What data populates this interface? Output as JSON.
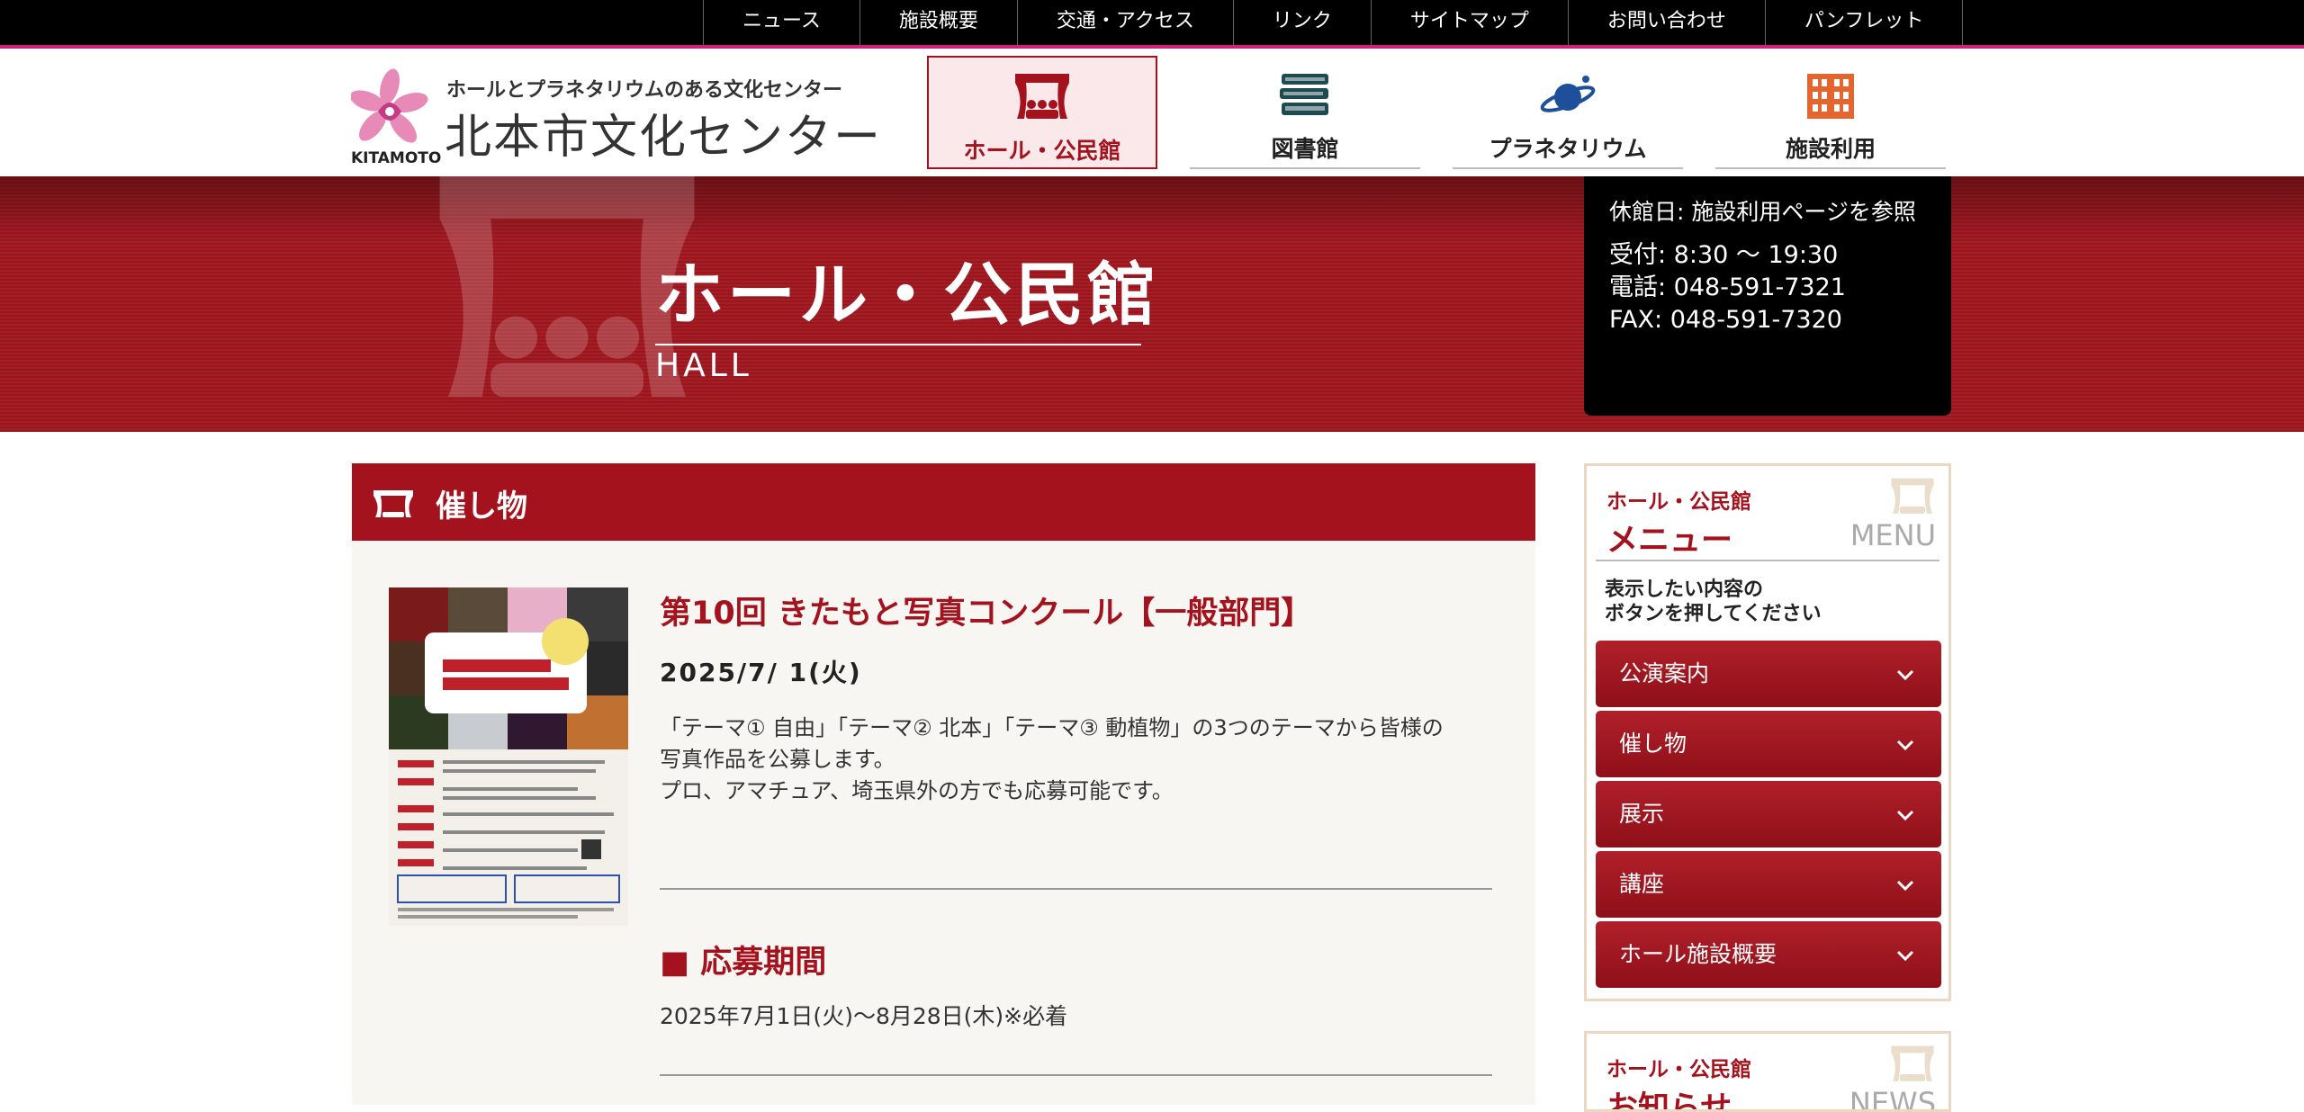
{
  "top_nav": [
    "ニュース",
    "施設概要",
    "交通・アクセス",
    "リンク",
    "サイトマップ",
    "お問い合わせ",
    "パンフレット"
  ],
  "logo": {
    "subtitle": "ホールとプラネタリウムのある文化センター",
    "name": "北本市文化センター",
    "en": "KITAMOTO"
  },
  "main_nav": [
    {
      "label": "ホール・公民館",
      "icon": "stage-icon",
      "active": true
    },
    {
      "label": "図書館",
      "icon": "books-icon",
      "active": false
    },
    {
      "label": "プラネタリウム",
      "icon": "planet-icon",
      "active": false
    },
    {
      "label": "施設利用",
      "icon": "building-icon",
      "active": false
    }
  ],
  "hero": {
    "title": "ホール・公民館",
    "en": "HALL",
    "info": {
      "closed": "休館日: 施設利用ページを参照",
      "reception": "受付: 8:30 〜 19:30",
      "phone": "電話: 048-591-7321",
      "fax": "FAX: 048-591-7320"
    }
  },
  "section": {
    "title": "催し物"
  },
  "event": {
    "title": "第10回 きたもと写真コンクール【一般部門】",
    "date": "2025/7/ 1(火)",
    "description": [
      "「テーマ① 自由」「テーマ② 北本」「テーマ③ 動植物」の3つのテーマから皆様の",
      "写真作品を公募します。",
      "プロ、アマチュア、埼玉県外の方でも応募可能です。"
    ],
    "sub_heading": "■ 応募期間",
    "sub_text": "2025年7月1日(火)〜8月28日(木)※必着"
  },
  "sidebar_menu": {
    "kicker": "ホール・公民館",
    "title": "メニュー",
    "en": "MENU",
    "help_line1": "表示したい内容の",
    "help_line2": "ボタンを押してください",
    "items": [
      "公演案内",
      "催し物",
      "展示",
      "講座",
      "ホール施設概要"
    ]
  },
  "sidebar_news": {
    "kicker": "ホール・公民館",
    "title": "お知らせ",
    "en": "NEWS"
  },
  "colors": {
    "accent": "#a3121d",
    "topbar": "#000000",
    "pink_line": "#d0207a"
  }
}
